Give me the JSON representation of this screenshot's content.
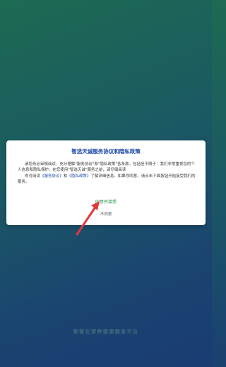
{
  "dialog": {
    "title": "智选天诚服务协议和隐私政策",
    "body": {
      "para1": "请您务必审慎阅读、充分理解\"服务协议\"和\"隐私政策\"各条款，包括但不限于：我们非常重视您的个人信息和隐私保护。在您使用\"智选天诚\"服务之前，请仔细阅读",
      "para2_prefix": "你可阅读",
      "link_service": "《服务协议》",
      "para2_and": "和",
      "link_privacy": "《隐私政策》",
      "para2_suffix": "了解详细信息。如果你同意，请点击下面按钮开始接受我们的服务。"
    },
    "agree_label": "同意并接受",
    "disagree_label": "不同意"
  },
  "footer": {
    "tagline": "数智化营养健康膳食平台"
  },
  "colors": {
    "title": "#1a47a8",
    "agree": "#1f8c47",
    "arrow": "#e0393c"
  },
  "icons": {
    "pointer_arrow": "arrow-icon"
  }
}
